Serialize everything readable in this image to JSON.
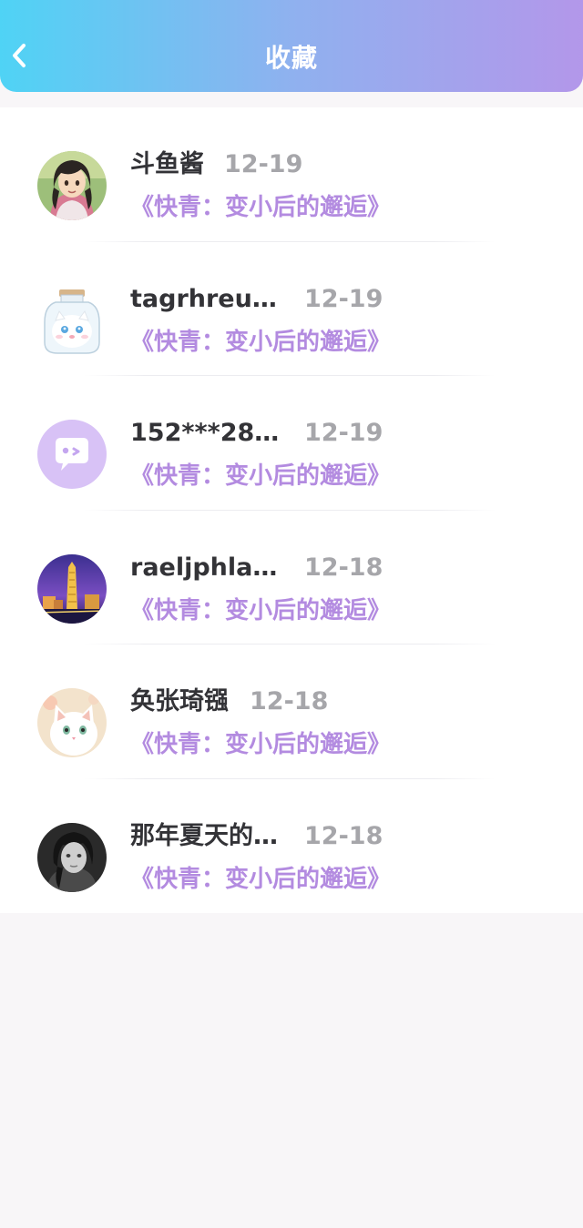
{
  "header": {
    "title": "收藏",
    "back_icon": "chevron-left-icon",
    "gradient": [
      "#4fd3f5",
      "#b397ea"
    ]
  },
  "colors": {
    "name": "#333337",
    "date": "#a6a6aa",
    "book": "#b38be0"
  },
  "favorites": [
    {
      "name": "斗鱼酱",
      "date": "12-19",
      "book": "《快青：变小后的邂逅》",
      "avatar": "anime-girl-avatar"
    },
    {
      "name": "tagrhreu…",
      "date": "12-19",
      "book": "《快青：变小后的邂逅》",
      "avatar": "cat-in-jar-avatar"
    },
    {
      "name": "152***28…",
      "date": "12-19",
      "book": "《快青：变小后的邂逅》",
      "avatar": "default-chat-avatar"
    },
    {
      "name": "raeljphla…",
      "date": "12-18",
      "book": "《快青：变小后的邂逅》",
      "avatar": "city-tower-night-avatar"
    },
    {
      "name": "奂张琦镪",
      "date": "12-18",
      "book": "《快青：变小后的邂逅》",
      "avatar": "white-cat-avatar"
    },
    {
      "name": "那年夏天的…",
      "date": "12-18",
      "book": "《快青：变小后的邂逅》",
      "avatar": "bw-portrait-avatar"
    }
  ]
}
